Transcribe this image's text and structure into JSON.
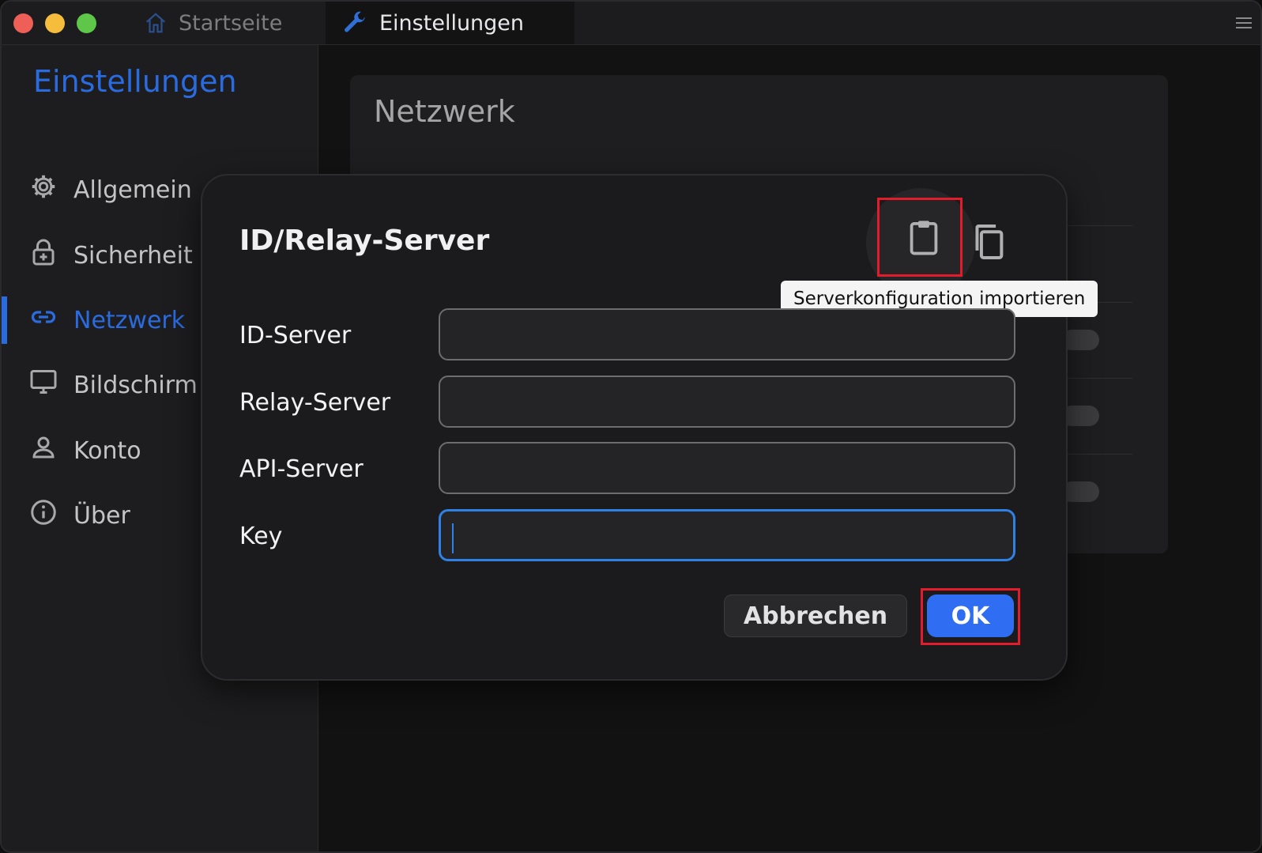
{
  "window": {
    "tabs": [
      {
        "label": "Startseite",
        "icon": "home-icon"
      },
      {
        "label": "Einstellungen",
        "icon": "wrench-icon"
      }
    ],
    "menu_icon": "hamburger-menu-icon"
  },
  "sidebar": {
    "title": "Einstellungen",
    "items": [
      {
        "label": "Allgemein",
        "icon": "gear-icon"
      },
      {
        "label": "Sicherheit",
        "icon": "lock-icon"
      },
      {
        "label": "Netzwerk",
        "icon": "link-icon",
        "active": true
      },
      {
        "label": "Bildschirm",
        "icon": "monitor-icon"
      },
      {
        "label": "Konto",
        "icon": "person-icon"
      },
      {
        "label": "Über",
        "icon": "info-icon"
      }
    ]
  },
  "main": {
    "card_title": "Netzwerk"
  },
  "dialog": {
    "title": "ID/Relay-Server",
    "tooltip": "Serverkonfiguration importieren",
    "fields": [
      {
        "label": "ID-Server",
        "value": ""
      },
      {
        "label": "Relay-Server",
        "value": ""
      },
      {
        "label": "API-Server",
        "value": ""
      },
      {
        "label": "Key",
        "value": ""
      }
    ],
    "cancel_label": "Abbrechen",
    "ok_label": "OK"
  },
  "colors": {
    "accent": "#2b6be0",
    "ok_button": "#2f6ef2",
    "highlight": "#e21c2b"
  }
}
